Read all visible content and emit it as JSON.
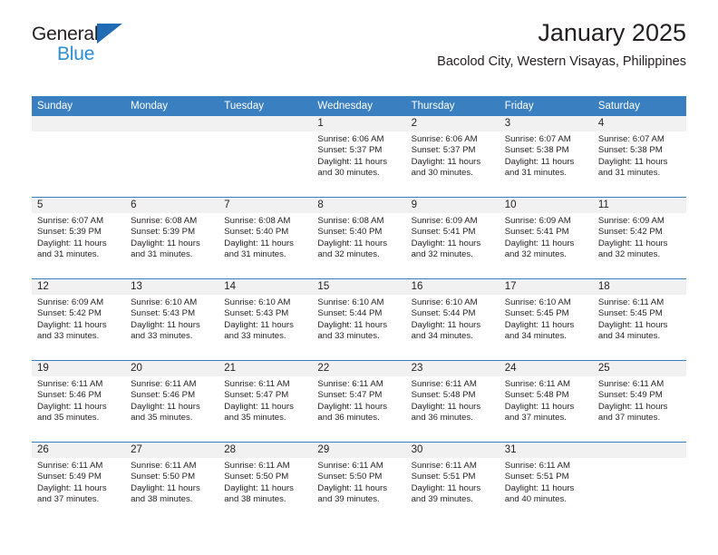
{
  "brand": {
    "line1": "General",
    "line2": "Blue",
    "triangle_color": "#1f6cb5",
    "line2_color": "#2a8fd4"
  },
  "header": {
    "title": "January 2025",
    "subtitle": "Bacolod City, Western Visayas, Philippines"
  },
  "calendar": {
    "header_bg": "#3a7fc0",
    "daystrip_bg": "#f1f1f1",
    "weekdays": [
      "Sunday",
      "Monday",
      "Tuesday",
      "Wednesday",
      "Thursday",
      "Friday",
      "Saturday"
    ],
    "weeks": [
      [
        {
          "day": "",
          "lines": []
        },
        {
          "day": "",
          "lines": []
        },
        {
          "day": "",
          "lines": []
        },
        {
          "day": "1",
          "lines": [
            "Sunrise: 6:06 AM",
            "Sunset: 5:37 PM",
            "Daylight: 11 hours",
            "and 30 minutes."
          ]
        },
        {
          "day": "2",
          "lines": [
            "Sunrise: 6:06 AM",
            "Sunset: 5:37 PM",
            "Daylight: 11 hours",
            "and 30 minutes."
          ]
        },
        {
          "day": "3",
          "lines": [
            "Sunrise: 6:07 AM",
            "Sunset: 5:38 PM",
            "Daylight: 11 hours",
            "and 31 minutes."
          ]
        },
        {
          "day": "4",
          "lines": [
            "Sunrise: 6:07 AM",
            "Sunset: 5:38 PM",
            "Daylight: 11 hours",
            "and 31 minutes."
          ]
        }
      ],
      [
        {
          "day": "5",
          "lines": [
            "Sunrise: 6:07 AM",
            "Sunset: 5:39 PM",
            "Daylight: 11 hours",
            "and 31 minutes."
          ]
        },
        {
          "day": "6",
          "lines": [
            "Sunrise: 6:08 AM",
            "Sunset: 5:39 PM",
            "Daylight: 11 hours",
            "and 31 minutes."
          ]
        },
        {
          "day": "7",
          "lines": [
            "Sunrise: 6:08 AM",
            "Sunset: 5:40 PM",
            "Daylight: 11 hours",
            "and 31 minutes."
          ]
        },
        {
          "day": "8",
          "lines": [
            "Sunrise: 6:08 AM",
            "Sunset: 5:40 PM",
            "Daylight: 11 hours",
            "and 32 minutes."
          ]
        },
        {
          "day": "9",
          "lines": [
            "Sunrise: 6:09 AM",
            "Sunset: 5:41 PM",
            "Daylight: 11 hours",
            "and 32 minutes."
          ]
        },
        {
          "day": "10",
          "lines": [
            "Sunrise: 6:09 AM",
            "Sunset: 5:41 PM",
            "Daylight: 11 hours",
            "and 32 minutes."
          ]
        },
        {
          "day": "11",
          "lines": [
            "Sunrise: 6:09 AM",
            "Sunset: 5:42 PM",
            "Daylight: 11 hours",
            "and 32 minutes."
          ]
        }
      ],
      [
        {
          "day": "12",
          "lines": [
            "Sunrise: 6:09 AM",
            "Sunset: 5:42 PM",
            "Daylight: 11 hours",
            "and 33 minutes."
          ]
        },
        {
          "day": "13",
          "lines": [
            "Sunrise: 6:10 AM",
            "Sunset: 5:43 PM",
            "Daylight: 11 hours",
            "and 33 minutes."
          ]
        },
        {
          "day": "14",
          "lines": [
            "Sunrise: 6:10 AM",
            "Sunset: 5:43 PM",
            "Daylight: 11 hours",
            "and 33 minutes."
          ]
        },
        {
          "day": "15",
          "lines": [
            "Sunrise: 6:10 AM",
            "Sunset: 5:44 PM",
            "Daylight: 11 hours",
            "and 33 minutes."
          ]
        },
        {
          "day": "16",
          "lines": [
            "Sunrise: 6:10 AM",
            "Sunset: 5:44 PM",
            "Daylight: 11 hours",
            "and 34 minutes."
          ]
        },
        {
          "day": "17",
          "lines": [
            "Sunrise: 6:10 AM",
            "Sunset: 5:45 PM",
            "Daylight: 11 hours",
            "and 34 minutes."
          ]
        },
        {
          "day": "18",
          "lines": [
            "Sunrise: 6:11 AM",
            "Sunset: 5:45 PM",
            "Daylight: 11 hours",
            "and 34 minutes."
          ]
        }
      ],
      [
        {
          "day": "19",
          "lines": [
            "Sunrise: 6:11 AM",
            "Sunset: 5:46 PM",
            "Daylight: 11 hours",
            "and 35 minutes."
          ]
        },
        {
          "day": "20",
          "lines": [
            "Sunrise: 6:11 AM",
            "Sunset: 5:46 PM",
            "Daylight: 11 hours",
            "and 35 minutes."
          ]
        },
        {
          "day": "21",
          "lines": [
            "Sunrise: 6:11 AM",
            "Sunset: 5:47 PM",
            "Daylight: 11 hours",
            "and 35 minutes."
          ]
        },
        {
          "day": "22",
          "lines": [
            "Sunrise: 6:11 AM",
            "Sunset: 5:47 PM",
            "Daylight: 11 hours",
            "and 36 minutes."
          ]
        },
        {
          "day": "23",
          "lines": [
            "Sunrise: 6:11 AM",
            "Sunset: 5:48 PM",
            "Daylight: 11 hours",
            "and 36 minutes."
          ]
        },
        {
          "day": "24",
          "lines": [
            "Sunrise: 6:11 AM",
            "Sunset: 5:48 PM",
            "Daylight: 11 hours",
            "and 37 minutes."
          ]
        },
        {
          "day": "25",
          "lines": [
            "Sunrise: 6:11 AM",
            "Sunset: 5:49 PM",
            "Daylight: 11 hours",
            "and 37 minutes."
          ]
        }
      ],
      [
        {
          "day": "26",
          "lines": [
            "Sunrise: 6:11 AM",
            "Sunset: 5:49 PM",
            "Daylight: 11 hours",
            "and 37 minutes."
          ]
        },
        {
          "day": "27",
          "lines": [
            "Sunrise: 6:11 AM",
            "Sunset: 5:50 PM",
            "Daylight: 11 hours",
            "and 38 minutes."
          ]
        },
        {
          "day": "28",
          "lines": [
            "Sunrise: 6:11 AM",
            "Sunset: 5:50 PM",
            "Daylight: 11 hours",
            "and 38 minutes."
          ]
        },
        {
          "day": "29",
          "lines": [
            "Sunrise: 6:11 AM",
            "Sunset: 5:50 PM",
            "Daylight: 11 hours",
            "and 39 minutes."
          ]
        },
        {
          "day": "30",
          "lines": [
            "Sunrise: 6:11 AM",
            "Sunset: 5:51 PM",
            "Daylight: 11 hours",
            "and 39 minutes."
          ]
        },
        {
          "day": "31",
          "lines": [
            "Sunrise: 6:11 AM",
            "Sunset: 5:51 PM",
            "Daylight: 11 hours",
            "and 40 minutes."
          ]
        },
        {
          "day": "",
          "lines": []
        }
      ]
    ]
  }
}
